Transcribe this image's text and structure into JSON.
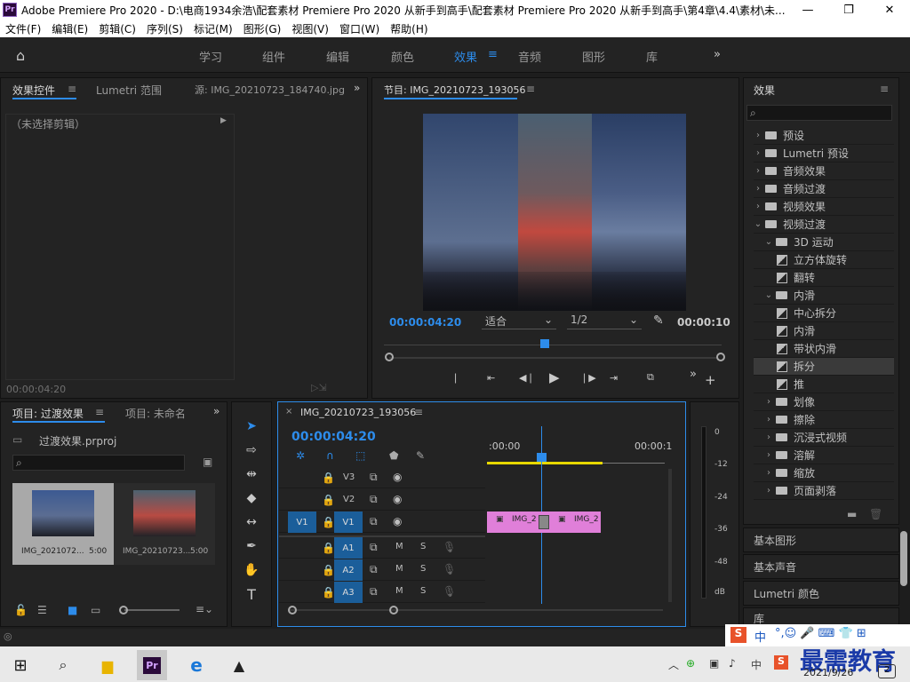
{
  "window": {
    "title": "Adobe Premiere Pro 2020 - D:\\电商1934余浩\\配套素材 Premiere Pro 2020 从新手到高手\\配套素材 Premiere Pro 2020 从新手到高手\\第4章\\4.4\\素材\\未...",
    "icon": "Pr"
  },
  "menu": [
    "文件(F)",
    "编辑(E)",
    "剪辑(C)",
    "序列(S)",
    "标记(M)",
    "图形(G)",
    "视图(V)",
    "窗口(W)",
    "帮助(H)"
  ],
  "workspaces": [
    "学习",
    "组件",
    "编辑",
    "颜色",
    "效果",
    "音频",
    "图形",
    "库"
  ],
  "workspace_active": "效果",
  "effect_controls": {
    "tabs": [
      "效果控件",
      "Lumetri 范围",
      "源: IMG_20210723_184740.jpg"
    ],
    "no_clip": "（未选择剪辑）",
    "timecode": "00:00:04:20"
  },
  "program": {
    "title": "节目: IMG_20210723_193056",
    "timecode": "00:00:04:20",
    "fit": "适合",
    "quality": "1/2",
    "duration": "00:00:10"
  },
  "project": {
    "tabs": [
      "项目: 过渡效果",
      "项目: 未命名"
    ],
    "file": "过渡效果.prproj",
    "items": [
      {
        "name": "IMG_2021072...",
        "dur": "5:00"
      },
      {
        "name": "IMG_20210723...",
        "dur": "5:00"
      }
    ]
  },
  "timeline": {
    "title": "IMG_20210723_193056",
    "timecode": "00:00:04:20",
    "ruler_start": ":00:00",
    "ruler_end": "00:00:1",
    "clip1": "IMG_2",
    "clip2": "IMG_2",
    "tracks": [
      {
        "name": "V3"
      },
      {
        "name": "V2"
      },
      {
        "name": "V1",
        "src": "V1"
      },
      {
        "name": "A1"
      },
      {
        "name": "A2"
      },
      {
        "name": "A3"
      }
    ],
    "m": "M",
    "s": "S"
  },
  "meter": [
    "0",
    "-12",
    "-24",
    "-36",
    "-48",
    "dB"
  ],
  "effects": {
    "title": "效果",
    "tree": [
      {
        "label": "预设",
        "level": 0,
        "type": "folder",
        "open": false
      },
      {
        "label": "Lumetri 预设",
        "level": 0,
        "type": "folder",
        "open": false
      },
      {
        "label": "音频效果",
        "level": 0,
        "type": "folder",
        "open": false
      },
      {
        "label": "音频过渡",
        "level": 0,
        "type": "folder",
        "open": false
      },
      {
        "label": "视频效果",
        "level": 0,
        "type": "folder",
        "open": false
      },
      {
        "label": "视频过渡",
        "level": 0,
        "type": "folder",
        "open": true
      },
      {
        "label": "3D 运动",
        "level": 1,
        "type": "folder",
        "open": true
      },
      {
        "label": "立方体旋转",
        "level": 2,
        "type": "item"
      },
      {
        "label": "翻转",
        "level": 2,
        "type": "item"
      },
      {
        "label": "内滑",
        "level": 1,
        "type": "folder",
        "open": true
      },
      {
        "label": "中心拆分",
        "level": 2,
        "type": "item"
      },
      {
        "label": "内滑",
        "level": 2,
        "type": "item"
      },
      {
        "label": "带状内滑",
        "level": 2,
        "type": "item"
      },
      {
        "label": "拆分",
        "level": 2,
        "type": "item",
        "selected": true
      },
      {
        "label": "推",
        "level": 2,
        "type": "item"
      },
      {
        "label": "划像",
        "level": 1,
        "type": "folder",
        "open": false
      },
      {
        "label": "擦除",
        "level": 1,
        "type": "folder",
        "open": false
      },
      {
        "label": "沉浸式视频",
        "level": 1,
        "type": "folder",
        "open": false
      },
      {
        "label": "溶解",
        "level": 1,
        "type": "folder",
        "open": false
      },
      {
        "label": "缩放",
        "level": 1,
        "type": "folder",
        "open": false
      },
      {
        "label": "页面剥落",
        "level": 1,
        "type": "folder",
        "open": false
      }
    ],
    "sections": [
      "基本图形",
      "基本声音",
      "Lumetri 颜色",
      "库"
    ]
  },
  "taskbar": {
    "date": "2021/9/26",
    "ime": "中",
    "badge": "2"
  },
  "watermark": "最需教育",
  "colors": {
    "accent": "#2d8ceb",
    "clip": "#e07fd9"
  }
}
